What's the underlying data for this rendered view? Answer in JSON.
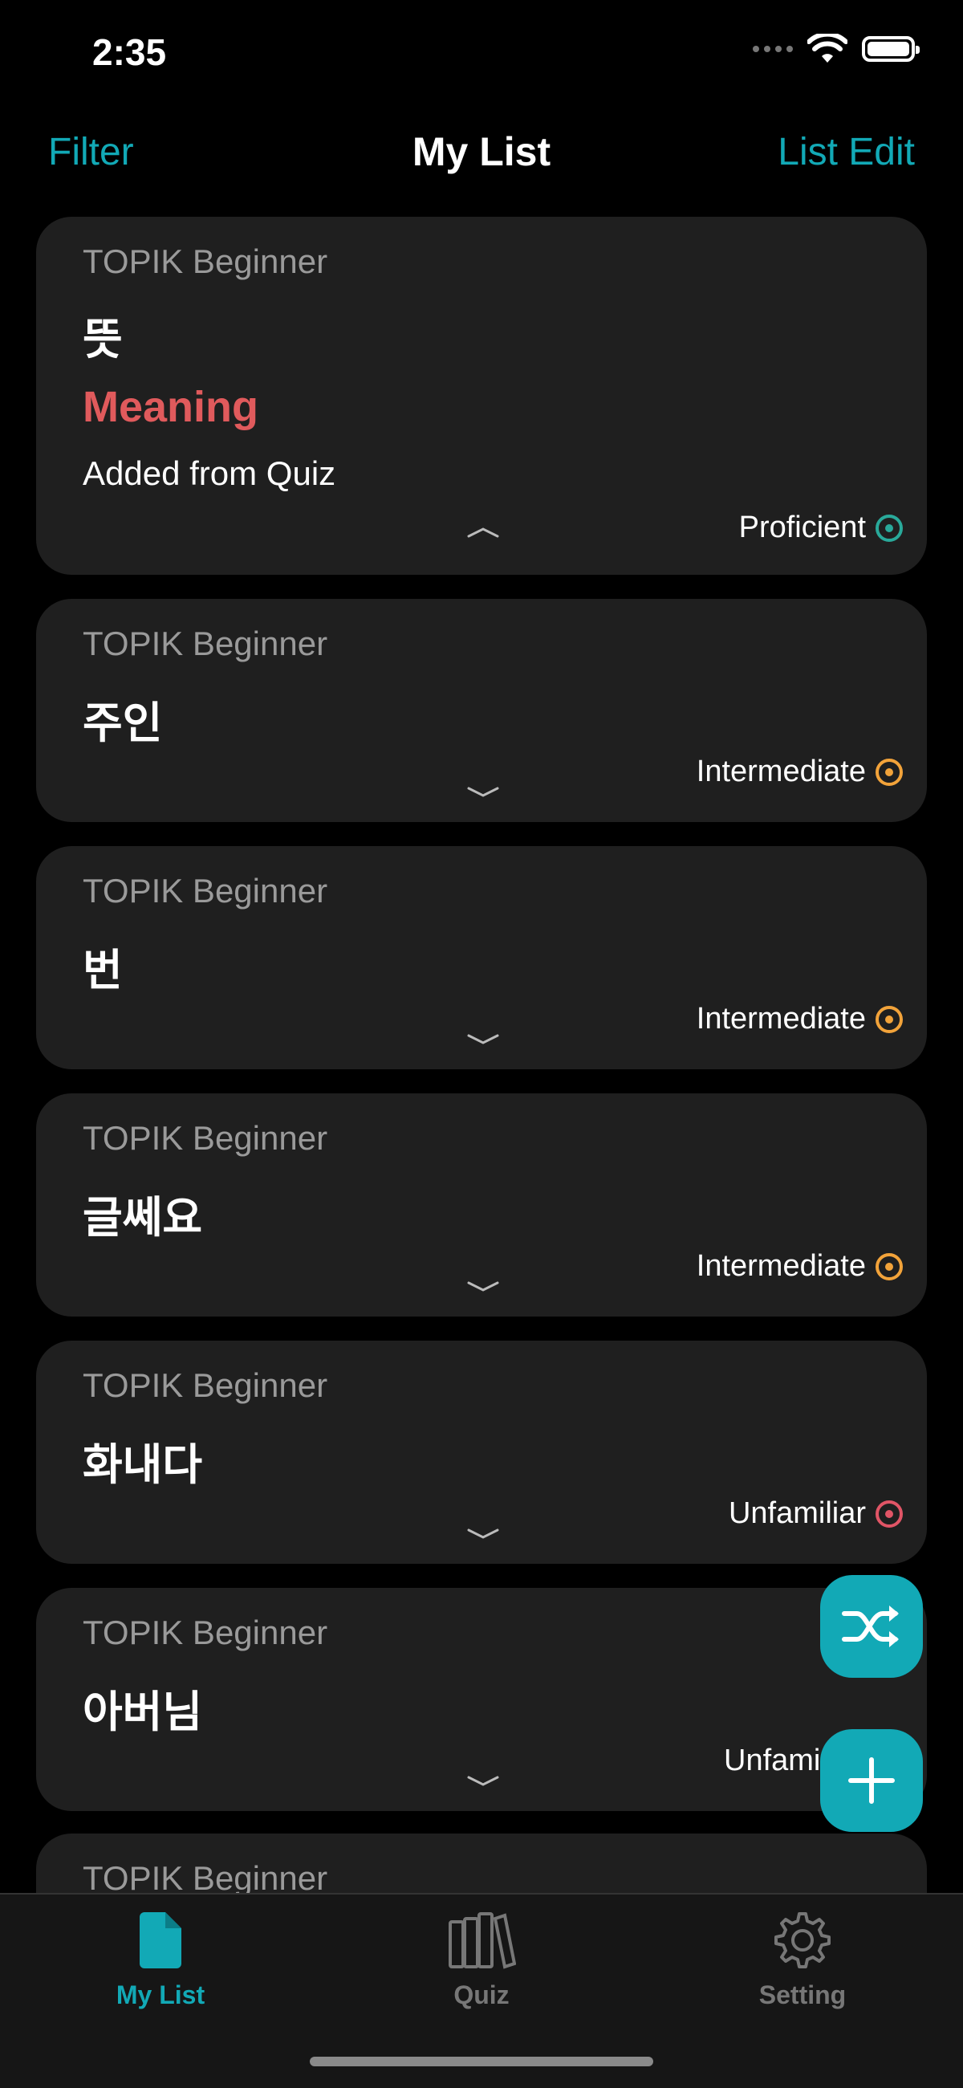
{
  "status_bar": {
    "time": "2:35"
  },
  "nav": {
    "left": "Filter",
    "title": "My List",
    "right": "List Edit"
  },
  "cards": [
    {
      "category": "TOPIK Beginner",
      "word": "뜻",
      "meaning": "Meaning",
      "note": "Added from Quiz",
      "level": "Proficient",
      "level_color": "#29a99a",
      "expanded": true
    },
    {
      "category": "TOPIK Beginner",
      "word": "주인",
      "level": "Intermediate",
      "level_color": "#f2a33a"
    },
    {
      "category": "TOPIK Beginner",
      "word": "번",
      "level": "Intermediate",
      "level_color": "#f2a33a"
    },
    {
      "category": "TOPIK Beginner",
      "word": "글쎄요",
      "level": "Intermediate",
      "level_color": "#f2a33a"
    },
    {
      "category": "TOPIK Beginner",
      "word": "화내다",
      "level": "Unfamiliar",
      "level_color": "#e15566"
    },
    {
      "category": "TOPIK Beginner",
      "word": "아버님",
      "level": "Unfami",
      "level_color": "#e15566"
    },
    {
      "category": "TOPIK Beginner"
    }
  ],
  "tabs": [
    {
      "label": "My List",
      "icon": "document-icon",
      "active": true
    },
    {
      "label": "Quiz",
      "icon": "books-icon",
      "active": false
    },
    {
      "label": "Setting",
      "icon": "gear-icon",
      "active": false
    }
  ],
  "colors": {
    "accent": "#12a9b6",
    "card_bg": "#1f1f1f",
    "meaning": "#e05a5c"
  }
}
